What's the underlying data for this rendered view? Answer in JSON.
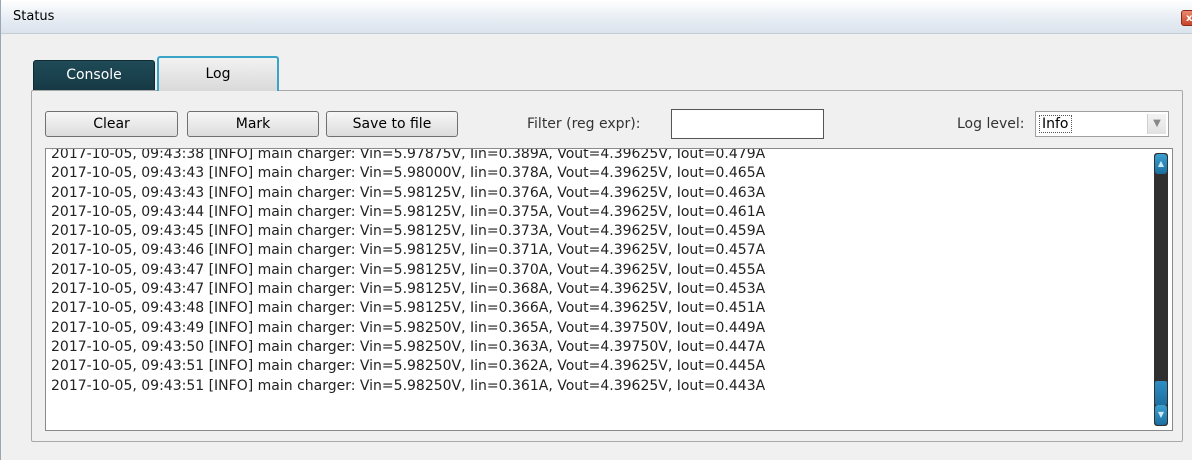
{
  "window": {
    "title": "Status",
    "close_symbol": "x"
  },
  "tabs": [
    {
      "label": "Console",
      "active": false
    },
    {
      "label": "Log",
      "active": true
    }
  ],
  "toolbar": {
    "clear_label": "Clear",
    "mark_label": "Mark",
    "save_label": "Save to file",
    "filter_label": "Filter (reg expr):",
    "filter_value": "",
    "log_level_label": "Log level:",
    "log_level_value": "Info"
  },
  "log": {
    "lines": [
      "2017-10-05, 09:43:38 [INFO] main charger: Vin=5.97875V, Iin=0.389A, Vout=4.39625V, Iout=0.479A",
      "2017-10-05, 09:43:43 [INFO] main charger: Vin=5.98000V, Iin=0.378A, Vout=4.39625V, Iout=0.465A",
      "2017-10-05, 09:43:43 [INFO] main charger: Vin=5.98125V, Iin=0.376A, Vout=4.39625V, Iout=0.463A",
      "2017-10-05, 09:43:44 [INFO] main charger: Vin=5.98125V, Iin=0.375A, Vout=4.39625V, Iout=0.461A",
      "2017-10-05, 09:43:45 [INFO] main charger: Vin=5.98125V, Iin=0.373A, Vout=4.39625V, Iout=0.459A",
      "2017-10-05, 09:43:46 [INFO] main charger: Vin=5.98125V, Iin=0.371A, Vout=4.39625V, Iout=0.457A",
      "2017-10-05, 09:43:47 [INFO] main charger: Vin=5.98125V, Iin=0.370A, Vout=4.39625V, Iout=0.455A",
      "2017-10-05, 09:43:47 [INFO] main charger: Vin=5.98125V, Iin=0.368A, Vout=4.39625V, Iout=0.453A",
      "2017-10-05, 09:43:48 [INFO] main charger: Vin=5.98125V, Iin=0.366A, Vout=4.39625V, Iout=0.451A",
      "2017-10-05, 09:43:49 [INFO] main charger: Vin=5.98250V, Iin=0.365A, Vout=4.39750V, Iout=0.449A",
      "2017-10-05, 09:43:50 [INFO] main charger: Vin=5.98250V, Iin=0.363A, Vout=4.39750V, Iout=0.447A",
      "2017-10-05, 09:43:51 [INFO] main charger: Vin=5.98250V, Iin=0.362A, Vout=4.39625V, Iout=0.445A",
      "2017-10-05, 09:43:51 [INFO] main charger: Vin=5.98250V, Iin=0.361A, Vout=4.39625V, Iout=0.443A"
    ]
  },
  "colors": {
    "active_tab_border": "#3aa3c8",
    "console_tab_bg": "#1f4a57",
    "scrollbar_track": "#303030",
    "scrollbar_accent": "#2e8ec4"
  }
}
